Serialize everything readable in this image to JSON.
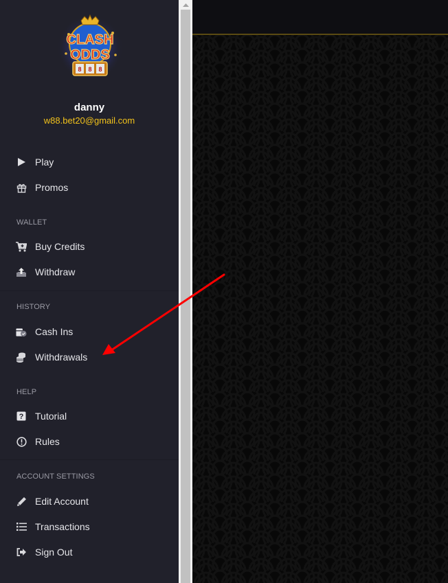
{
  "brand": {
    "logo_alt": "Clash Odds",
    "logo_line1": "CLASH",
    "logo_line2": "ODDS",
    "reels": [
      "8",
      "8",
      "8"
    ]
  },
  "profile": {
    "username": "danny",
    "email": "w88.bet20@gmail.com"
  },
  "nav": {
    "main": [
      {
        "label": "Play",
        "icon": "play-icon"
      },
      {
        "label": "Promos",
        "icon": "gift-icon"
      }
    ],
    "wallet": {
      "title": "WALLET",
      "items": [
        {
          "label": "Buy Credits",
          "icon": "cart-plus-icon"
        },
        {
          "label": "Withdraw",
          "icon": "upload-icon"
        }
      ]
    },
    "history": {
      "title": "HISTORY",
      "items": [
        {
          "label": "Cash Ins",
          "icon": "cash-check-icon"
        },
        {
          "label": "Withdrawals",
          "icon": "coins-icon"
        }
      ]
    },
    "help": {
      "title": "HELP",
      "items": [
        {
          "label": "Tutorial",
          "icon": "question-square-icon"
        },
        {
          "label": "Rules",
          "icon": "exclamation-circle-icon"
        }
      ]
    },
    "account": {
      "title": "ACCOUNT SETTINGS",
      "items": [
        {
          "label": "Edit Account",
          "icon": "pencil-icon"
        },
        {
          "label": "Transactions",
          "icon": "list-icon"
        },
        {
          "label": "Sign Out",
          "icon": "sign-out-icon"
        }
      ]
    }
  },
  "colors": {
    "sidebar_bg": "#21212b",
    "email_accent": "#f2c21b",
    "header_border": "#5a4a12",
    "annotation_arrow": "#ff0000"
  },
  "annotation": {
    "type": "arrow",
    "points_to": "Withdrawals"
  }
}
